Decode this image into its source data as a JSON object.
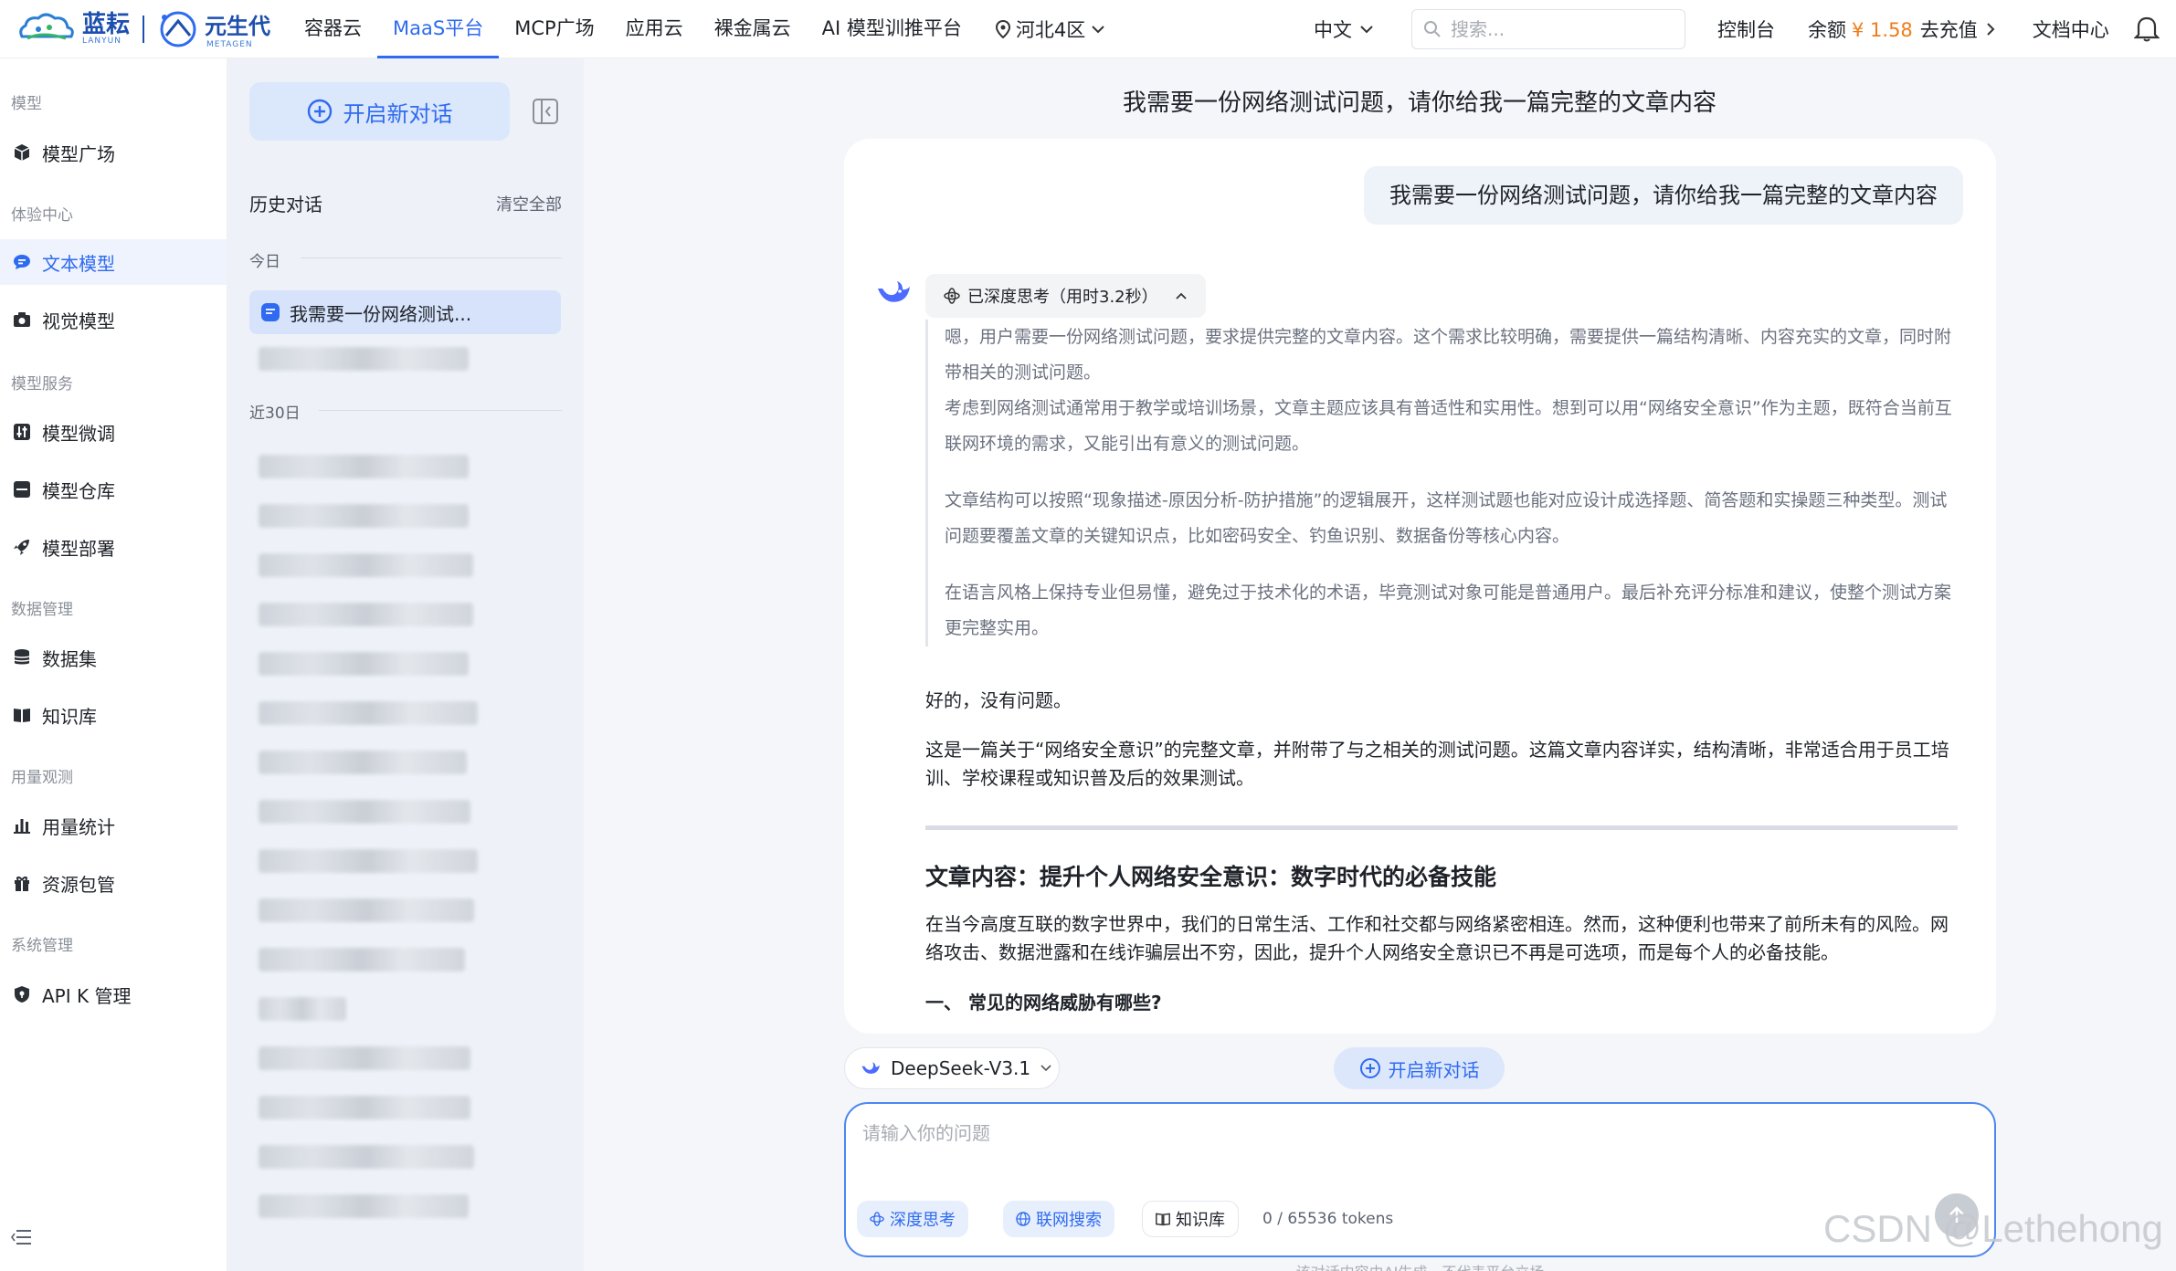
{
  "brand": {
    "logo_a_text": "蓝耘",
    "logo_a_sub": "LANYUN",
    "logo_b_text": "元生代",
    "logo_b_sub": "METAGEN"
  },
  "nav": {
    "items": [
      "容器云",
      "MaaS平台",
      "MCP广场",
      "应用云",
      "裸金属云",
      "AI 模型训推平台"
    ],
    "active_index": 1,
    "region": "河北4区",
    "language": "中文",
    "search_placeholder": "搜索...",
    "console": "控制台",
    "balance_label": "余额",
    "balance_amount": "¥ 1.58",
    "recharge": "去充值",
    "docs": "文档中心"
  },
  "sidebar": {
    "sections": [
      {
        "title": "模型",
        "items": [
          {
            "label": "模型广场",
            "icon": "cube-icon"
          }
        ]
      },
      {
        "title": "体验中心",
        "items": [
          {
            "label": "文本模型",
            "icon": "chat-bubble-icon",
            "active": true
          },
          {
            "label": "视觉模型",
            "icon": "camera-icon"
          }
        ]
      },
      {
        "title": "模型服务",
        "items": [
          {
            "label": "模型微调",
            "icon": "sliders-icon"
          },
          {
            "label": "模型仓库",
            "icon": "archive-icon"
          },
          {
            "label": "模型部署",
            "icon": "rocket-icon"
          }
        ]
      },
      {
        "title": "数据管理",
        "items": [
          {
            "label": "数据集",
            "icon": "database-icon"
          },
          {
            "label": "知识库",
            "icon": "book-icon"
          }
        ]
      },
      {
        "title": "用量观测",
        "items": [
          {
            "label": "用量统计",
            "icon": "bar-chart-icon"
          },
          {
            "label": "资源包管",
            "icon": "gift-icon"
          }
        ]
      },
      {
        "title": "系统管理",
        "items": [
          {
            "label": "API K  管理",
            "icon": "shield-icon"
          }
        ]
      }
    ]
  },
  "history": {
    "new_chat": "开启新对话",
    "title": "历史对话",
    "clear_all": "清空全部",
    "today_label": "今日",
    "last30_label": "近30日",
    "active_item": "我需要一份网络测试..."
  },
  "conversation": {
    "title": "我需要一份网络测试问题，请你给我一篇完整的文章内容",
    "user_message": "我需要一份网络测试问题，请你给我一篇完整的文章内容",
    "thinking_label": "已深度思考（用时3.2秒）",
    "thinking_paragraphs": [
      "嗯，用户需要一份网络测试问题，要求提供完整的文章内容。这个需求比较明确，需要提供一篇结构清晰、内容充实的文章，同时附带相关的测试问题。",
      "考虑到网络测试通常用于教学或培训场景，文章主题应该具有普适性和实用性。想到可以用“网络安全意识”作为主题，既符合当前互联网环境的需求，又能引出有意义的测试问题。",
      "文章结构可以按照“现象描述-原因分析-防护措施”的逻辑展开，这样测试题也能对应设计成选择题、简答题和实操题三种类型。测试问题要覆盖文章的关键知识点，比如密码安全、钓鱼识别、数据备份等核心内容。",
      "在语言风格上保持专业但易懂，避免过于技术化的术语，毕竟测试对象可能是普通用户。最后补充评分标准和建议，使整个测试方案更完整实用。"
    ],
    "answer_intro": "好的，没有问题。",
    "answer_desc": "这是一篇关于“网络安全意识”的完整文章，并附带了与之相关的测试问题。这篇文章内容详实，结构清晰，非常适合用于员工培训、学校课程或知识普及后的效果测试。",
    "article_title": "文章内容：提升个人网络安全意识：数字时代的必备技能",
    "article_para": "在当今高度互联的数字世界中，我们的日常生活、工作和社交都与网络紧密相连。然而，这种便利也带来了前所未有的风险。网络攻击、数据泄露和在线诈骗层出不穷，因此，提升个人网络安全意识已不再是可选项，而是每个人的必备技能。",
    "section_heading": "一、 常见的网络威胁有哪些?"
  },
  "composer": {
    "model": "DeepSeek-V3.1",
    "new_chat": "开启新对话",
    "placeholder": "请输入你的问题",
    "deep_think": "深度思考",
    "web_search": "联网搜索",
    "knowledge": "知识库",
    "tokens": "0 / 65536 tokens",
    "disclaimer": "该对话内容由AI生成，不代表平台立场"
  },
  "watermark": "CSDN @Lethehong",
  "colors": {
    "accent": "#2f6bf0",
    "balance": "#f07c1b",
    "history_bg": "#eef2f8",
    "main_bg": "#f4f6fa"
  }
}
